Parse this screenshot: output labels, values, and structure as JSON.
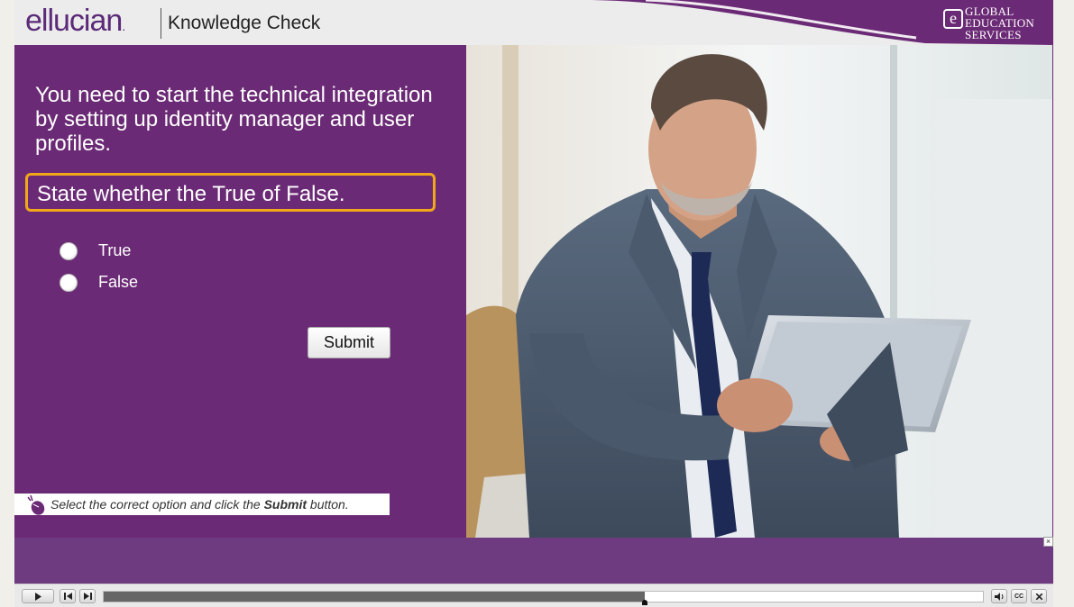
{
  "header": {
    "logo_text": "ellucian",
    "logo_dot": ".",
    "title": "Knowledge Check",
    "brand_lines": [
      "GLOBAL",
      "EDUCATION",
      "SERVICES"
    ],
    "brand_letter": "e"
  },
  "quiz": {
    "question": "You need to start the technical integration by setting up identity manager and user profiles.",
    "instruction": "State whether the True of False.",
    "options": [
      {
        "label": "True",
        "selected": false
      },
      {
        "label": "False",
        "selected": false
      }
    ],
    "submit_label": "Submit"
  },
  "hint": {
    "prefix": "Select the correct option and click the ",
    "emphasis": "Submit",
    "suffix": " button."
  },
  "player": {
    "progress_fraction": 0.615,
    "close_label": "×",
    "cc_label": "CC"
  },
  "colors": {
    "brand_purple": "#6b2a75",
    "highlight_orange": "#f0a818"
  }
}
